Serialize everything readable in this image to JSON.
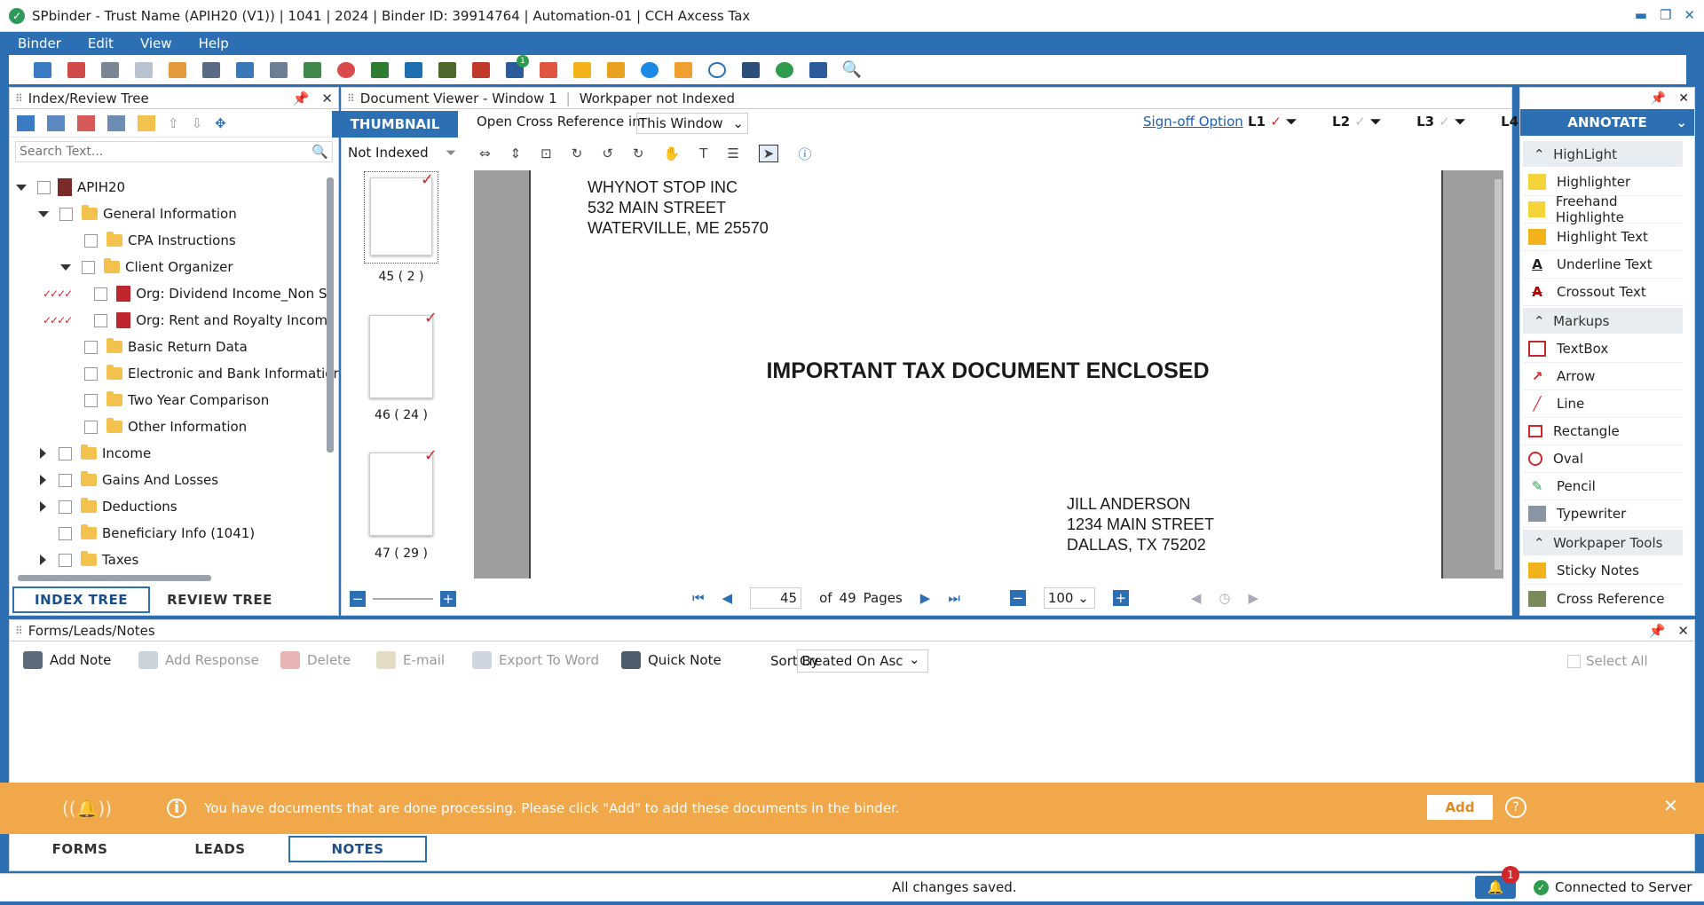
{
  "window": {
    "title": "SPbinder - Trust Name (APIH20 (V1)) | 1041 | 2024 | Binder ID: 39914764 | Automation-01 | CCH Axcess Tax"
  },
  "menu": [
    "Binder",
    "Edit",
    "View",
    "Help"
  ],
  "toolbar": {
    "badge": "1"
  },
  "index_panel": {
    "title": "Index/Review Tree",
    "search_placeholder": "Search Text...",
    "tree": [
      {
        "label": "APIH20"
      },
      {
        "label": "General Information"
      },
      {
        "label": "CPA Instructions"
      },
      {
        "label": "Client Organizer"
      },
      {
        "label": "Org: Dividend Income_Non S"
      },
      {
        "label": "Org: Rent and Royalty Incom"
      },
      {
        "label": "Basic Return Data"
      },
      {
        "label": "Electronic and Bank Informatior"
      },
      {
        "label": "Two Year Comparison"
      },
      {
        "label": "Other Information"
      },
      {
        "label": "Income"
      },
      {
        "label": "Gains And Losses"
      },
      {
        "label": "Deductions"
      },
      {
        "label": "Beneficiary Info (1041)"
      },
      {
        "label": "Taxes"
      }
    ],
    "tabs": [
      "INDEX TREE",
      "REVIEW TREE"
    ]
  },
  "viewer": {
    "title": "Document Viewer - Window 1",
    "subtitle": "Workpaper not Indexed",
    "thumb_tab": "THUMBNAIL",
    "filter": "Not Indexed",
    "thumbs": [
      "45 ( 2 )",
      "46 ( 24 )",
      "47 ( 29 )"
    ],
    "cross_label": "Open Cross Reference in:",
    "cross_value": "This Window",
    "signoff": "Sign-off Option",
    "levels": [
      "L1",
      "L2",
      "L3",
      "L4"
    ],
    "doc": {
      "from": [
        "WHYNOT STOP INC",
        "532 MAIN STREET",
        "WATERVILLE, ME 25570"
      ],
      "heading": "IMPORTANT TAX DOCUMENT ENCLOSED",
      "to": [
        "JILL ANDERSON",
        "1234 MAIN STREET",
        "DALLAS, TX 75202"
      ]
    },
    "nav": {
      "page": "45",
      "of": "of",
      "total": "49",
      "pages": "Pages",
      "zoom": "100"
    }
  },
  "annotate": {
    "title": "ANNOTATE",
    "sections": [
      {
        "name": "HighLight",
        "items": [
          "Highlighter",
          "Freehand Highlighte",
          "Highlight Text",
          "Underline Text",
          "Crossout Text"
        ]
      },
      {
        "name": "Markups",
        "items": [
          "TextBox",
          "Arrow",
          "Line",
          "Rectangle",
          "Oval",
          "Pencil",
          "Typewriter"
        ]
      },
      {
        "name": "Workpaper Tools",
        "items": [
          "Sticky Notes",
          "Cross Reference"
        ]
      }
    ]
  },
  "notes": {
    "title": "Forms/Leads/Notes",
    "buttons": [
      "Add Note",
      "Add Response",
      "Delete",
      "E-mail",
      "Export To Word",
      "Quick Note"
    ],
    "sort_label": "Sort By",
    "sort_value": "Created On Asc",
    "select_all": "Select All",
    "tabs": [
      "FORMS",
      "LEADS",
      "NOTES"
    ]
  },
  "banner": {
    "message": "You have documents that are done processing. Please click \"Add\" to add these documents in the binder.",
    "add": "Add"
  },
  "status": {
    "saved": "All changes saved.",
    "connected": "Connected to Server",
    "bell_count": "1"
  },
  "colors": {
    "brand": "#2c6fb3",
    "banner": "#f0a84a",
    "check": "#d0272d"
  }
}
